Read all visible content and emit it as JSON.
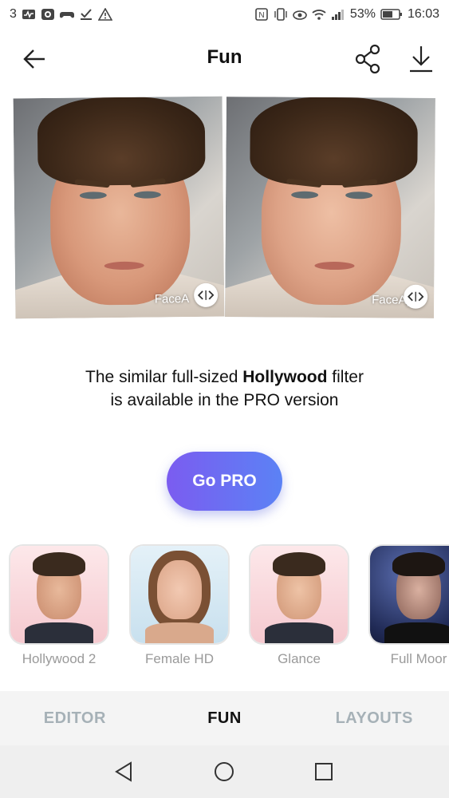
{
  "status_bar": {
    "notification_count": "3",
    "battery_percent": "53%",
    "time": "16:03",
    "left_icons": [
      "activity-icon",
      "camera-app-icon",
      "game-controller-icon",
      "download-done-icon",
      "warning-icon"
    ],
    "right_icons": [
      "nfc-icon",
      "vibrate-icon",
      "eye-comfort-icon",
      "wifi-icon",
      "signal-icon",
      "battery-icon"
    ]
  },
  "header": {
    "title": "Fun",
    "back_icon": "arrow-left-icon",
    "share_icon": "share-icon",
    "download_icon": "download-icon"
  },
  "comparison": {
    "watermark_left": "FaceA",
    "watermark_right": "FaceApp",
    "handle_icon": "compare-arrows-icon"
  },
  "promo": {
    "line1_before": "The similar full-sized ",
    "line1_bold": "Hollywood",
    "line1_after": " filter",
    "line2": "is available in the PRO version"
  },
  "cta": {
    "label": "Go PRO"
  },
  "filters": [
    {
      "label": "Hollywood 2"
    },
    {
      "label": "Female HD"
    },
    {
      "label": "Glance"
    },
    {
      "label": "Full Moor"
    }
  ],
  "tabs": [
    {
      "label": "EDITOR",
      "active": false
    },
    {
      "label": "FUN",
      "active": true
    },
    {
      "label": "LAYOUTS",
      "active": false
    }
  ],
  "navbar": {
    "back_icon": "nav-back-icon",
    "home_icon": "nav-home-icon",
    "recents_icon": "nav-recents-icon"
  },
  "colors": {
    "cta_start": "#7b5cf0",
    "cta_end": "#5b82f5",
    "tab_active": "#111111",
    "tab_inactive": "#a6b1b7"
  }
}
